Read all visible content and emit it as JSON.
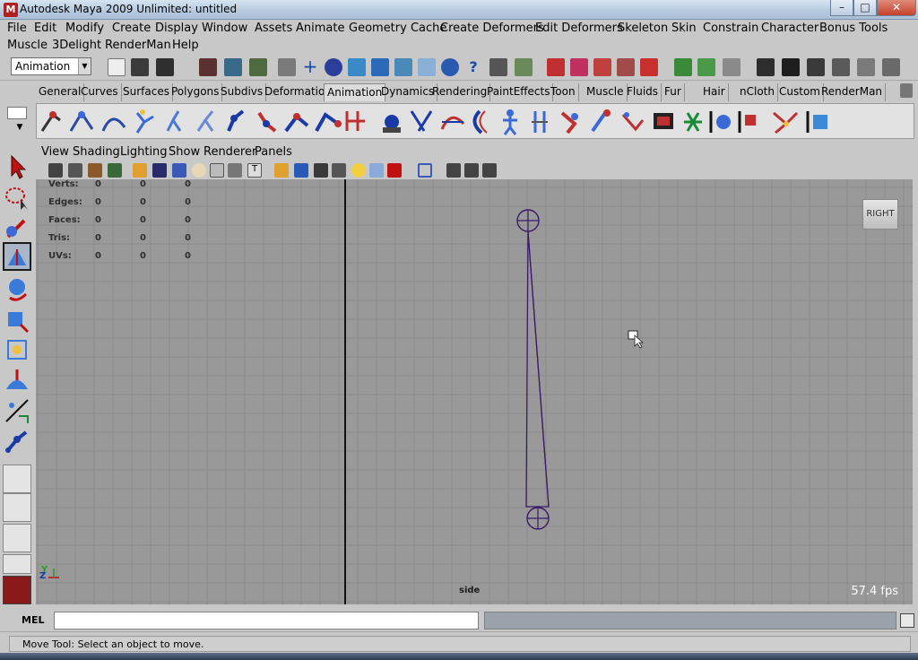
{
  "window": {
    "title": "Autodesk Maya 2009 Unlimited: untitled",
    "app_icon": "maya-icon"
  },
  "menubar": {
    "items": [
      "File",
      "Edit",
      "Modify",
      "Create",
      "Display",
      "Window",
      "Assets",
      "Animate",
      "Geometry Cache",
      "Create Deformers",
      "Edit Deformers",
      "Skeleton",
      "Skin",
      "Constrain",
      "Character",
      "Bonus Tools",
      "Muscle",
      "3Delight",
      "RenderMan",
      "Help"
    ]
  },
  "statusline": {
    "mode": "Animation"
  },
  "shelf": {
    "tabs": [
      "General",
      "Curves",
      "Surfaces",
      "Polygons",
      "Subdivs",
      "Deformation",
      "Animation",
      "Dynamics",
      "Rendering",
      "PaintEffects",
      "Toon",
      "Muscle",
      "Fluids",
      "Fur",
      "Hair",
      "nCloth",
      "Custom",
      "RenderMan"
    ],
    "active_tab": "Animation"
  },
  "panel": {
    "menus": [
      "View",
      "Shading",
      "Lighting",
      "Show",
      "Renderer",
      "Panels"
    ]
  },
  "hud": {
    "rows": [
      {
        "label": "Verts:",
        "values": [
          "0",
          "0",
          "0"
        ]
      },
      {
        "label": "Edges:",
        "values": [
          "0",
          "0",
          "0"
        ]
      },
      {
        "label": "Faces:",
        "values": [
          "0",
          "0",
          "0"
        ]
      },
      {
        "label": "Tris:",
        "values": [
          "0",
          "0",
          "0"
        ]
      },
      {
        "label": "UVs:",
        "values": [
          "0",
          "0",
          "0"
        ]
      }
    ]
  },
  "viewport": {
    "view_cube": "RIGHT",
    "camera": "side",
    "fps": "57.4 fps",
    "axis": {
      "y": "Y",
      "z": "Z"
    },
    "colors": {
      "background": "#999999",
      "grid": "#8a8a8a",
      "joint": "#3a1a6a"
    }
  },
  "commandline": {
    "label": "MEL",
    "value": ""
  },
  "helpline": {
    "text": "Move Tool: Select an object to move."
  }
}
